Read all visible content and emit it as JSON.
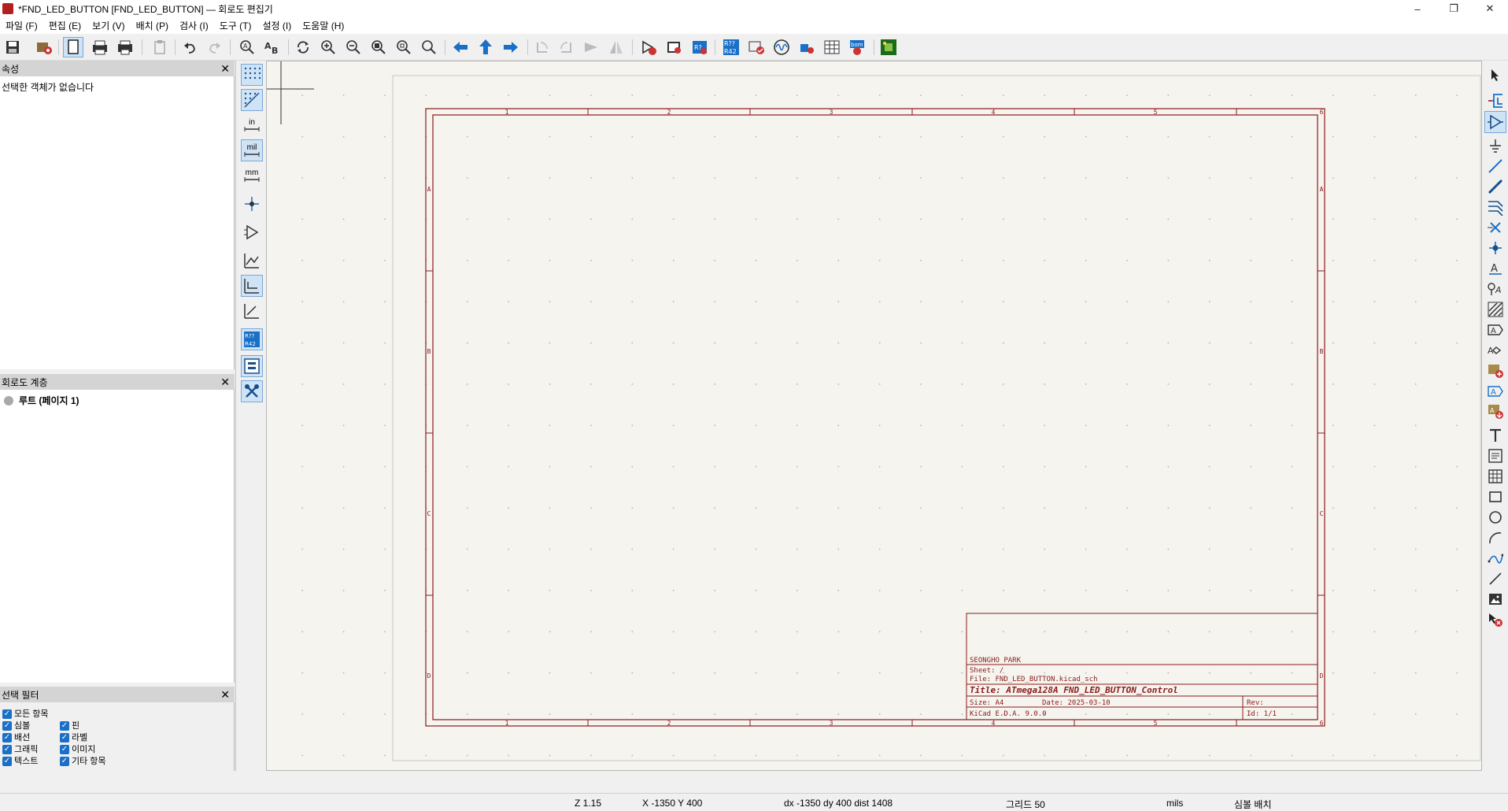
{
  "window": {
    "title": "*FND_LED_BUTTON [FND_LED_BUTTON] — 회로도 편집기"
  },
  "menu": [
    "파일 (F)",
    "편집 (E)",
    "보기 (V)",
    "배치 (P)",
    "검사 (I)",
    "도구 (T)",
    "설정 (I)",
    "도움말 (H)"
  ],
  "properties": {
    "title": "속성",
    "empty_text": "선택한 객체가 없습니다"
  },
  "hierarchy": {
    "title": "회로도 계층",
    "root_label": "루트 (페이지 1)"
  },
  "filter": {
    "title": "선택 필터",
    "items": [
      "모든 항목",
      "핀",
      "심볼",
      "라벨",
      "배선",
      "이미지",
      "그래픽",
      "기타 항목",
      "텍스트"
    ]
  },
  "left_tools": {
    "in": "in",
    "mil": "mil",
    "mm": "mm"
  },
  "titleblock": {
    "company": "SEONGHO PARK",
    "sheet": "Sheet: /",
    "file": "File: FND_LED_BUTTON.kicad_sch",
    "title": "Title: ATmega128A FND_LED_BUTTON_Control",
    "size": "Size: A4",
    "date": "Date: 2025-03-10",
    "rev": "Rev:",
    "tool": "KiCad E.D.A. 9.0.0",
    "id": "Id: 1/1"
  },
  "frame_labels": {
    "cols": [
      "1",
      "2",
      "3",
      "4",
      "5",
      "6"
    ],
    "rows": [
      "A",
      "B",
      "C",
      "D"
    ]
  },
  "status": {
    "zoom": "Z 1.15",
    "xy": "X -1350  Y 400",
    "delta": "dx -1350  dy 400  dist 1408",
    "grid": "그리드 50",
    "units": "mils",
    "mode": "심볼 배치"
  },
  "colors": {
    "frame": "#8b1a1a",
    "canvas": "#f5f4ef",
    "accent": "#1a6fc7"
  }
}
